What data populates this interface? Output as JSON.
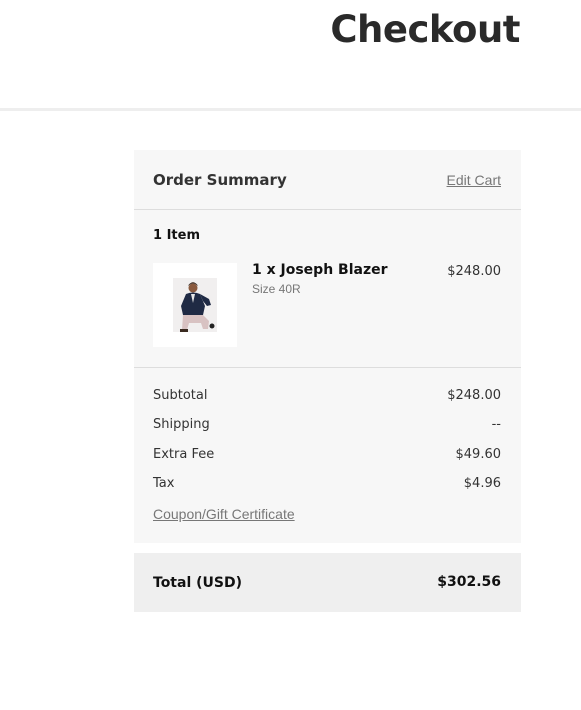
{
  "header": {
    "title": "Checkout"
  },
  "order_summary": {
    "title": "Order Summary",
    "edit_cart_label": "Edit Cart",
    "item_count": "1 Item",
    "items": [
      {
        "name": "1 x Joseph Blazer",
        "option": "Size 40R",
        "price": "$248.00",
        "image_icon": "product-photo-man-in-navy-blazer"
      }
    ],
    "totals": [
      {
        "label": "Subtotal",
        "value": "$248.00"
      },
      {
        "label": "Shipping",
        "value": "--"
      },
      {
        "label": "Extra Fee",
        "value": "$49.60"
      },
      {
        "label": "Tax",
        "value": "$4.96"
      }
    ],
    "coupon_label": "Coupon/Gift Certificate",
    "grand_total": {
      "label": "Total (USD)",
      "value": "$302.56"
    }
  },
  "colors": {
    "panel_background": "#f7f7f7",
    "total_background": "#efefef",
    "link": "#777777",
    "divider": "#dddddd"
  }
}
